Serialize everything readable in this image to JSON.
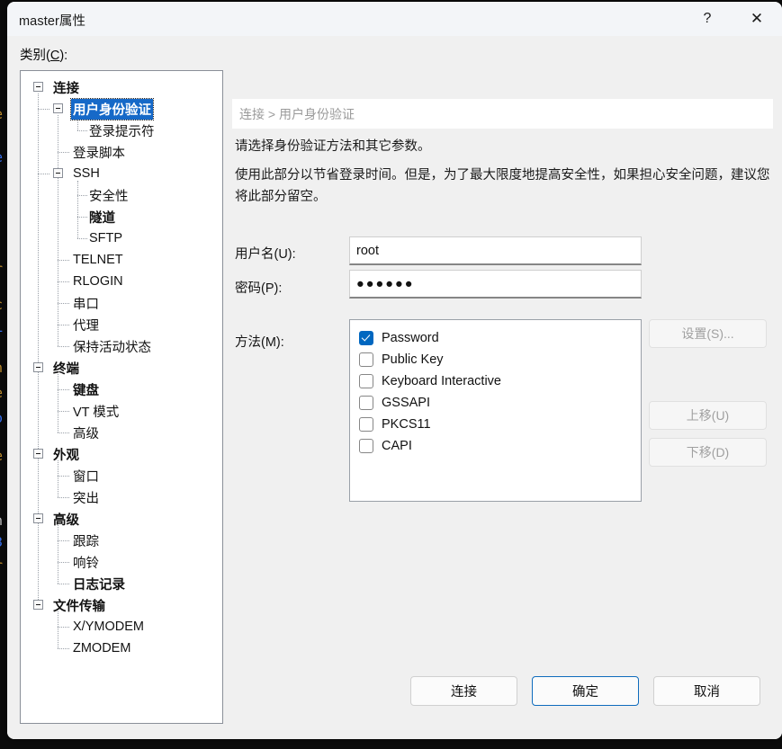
{
  "window": {
    "title": "master属性",
    "help_label": "?",
    "close_label": "✕"
  },
  "category": {
    "label_prefix": "类别(",
    "accel": "C",
    "label_suffix": "):"
  },
  "tree": {
    "items": [
      {
        "label": "连接",
        "depth": 0,
        "bold": true,
        "expander": true,
        "selected": false
      },
      {
        "label": "用户身份验证",
        "depth": 1,
        "bold": true,
        "expander": true,
        "selected": true
      },
      {
        "label": "登录提示符",
        "depth": 2,
        "bold": false,
        "expander": false,
        "selected": false
      },
      {
        "label": "登录脚本",
        "depth": 1,
        "bold": false,
        "expander": false,
        "selected": false
      },
      {
        "label": "SSH",
        "depth": 1,
        "bold": false,
        "expander": true,
        "selected": false
      },
      {
        "label": "安全性",
        "depth": 2,
        "bold": false,
        "expander": false,
        "selected": false
      },
      {
        "label": "隧道",
        "depth": 2,
        "bold": true,
        "expander": false,
        "selected": false
      },
      {
        "label": "SFTP",
        "depth": 2,
        "bold": false,
        "expander": false,
        "selected": false
      },
      {
        "label": "TELNET",
        "depth": 1,
        "bold": false,
        "expander": false,
        "selected": false
      },
      {
        "label": "RLOGIN",
        "depth": 1,
        "bold": false,
        "expander": false,
        "selected": false
      },
      {
        "label": "串口",
        "depth": 1,
        "bold": false,
        "expander": false,
        "selected": false
      },
      {
        "label": "代理",
        "depth": 1,
        "bold": false,
        "expander": false,
        "selected": false
      },
      {
        "label": "保持活动状态",
        "depth": 1,
        "bold": false,
        "expander": false,
        "selected": false
      },
      {
        "label": "终端",
        "depth": 0,
        "bold": true,
        "expander": true,
        "selected": false
      },
      {
        "label": "键盘",
        "depth": 1,
        "bold": true,
        "expander": false,
        "selected": false
      },
      {
        "label": "VT 模式",
        "depth": 1,
        "bold": false,
        "expander": false,
        "selected": false
      },
      {
        "label": "高级",
        "depth": 1,
        "bold": false,
        "expander": false,
        "selected": false
      },
      {
        "label": "外观",
        "depth": 0,
        "bold": true,
        "expander": true,
        "selected": false
      },
      {
        "label": "窗口",
        "depth": 1,
        "bold": false,
        "expander": false,
        "selected": false
      },
      {
        "label": "突出",
        "depth": 1,
        "bold": false,
        "expander": false,
        "selected": false
      },
      {
        "label": "高级",
        "depth": 0,
        "bold": true,
        "expander": true,
        "selected": false
      },
      {
        "label": "跟踪",
        "depth": 1,
        "bold": false,
        "expander": false,
        "selected": false
      },
      {
        "label": "响铃",
        "depth": 1,
        "bold": false,
        "expander": false,
        "selected": false
      },
      {
        "label": "日志记录",
        "depth": 1,
        "bold": true,
        "expander": false,
        "selected": false
      },
      {
        "label": "文件传输",
        "depth": 0,
        "bold": true,
        "expander": true,
        "selected": false
      },
      {
        "label": "X/YMODEM",
        "depth": 1,
        "bold": false,
        "expander": false,
        "selected": false
      },
      {
        "label": "ZMODEM",
        "depth": 1,
        "bold": false,
        "expander": false,
        "selected": false
      }
    ]
  },
  "content": {
    "breadcrumb": "连接 > 用户身份验证",
    "description_1": "请选择身份验证方法和其它参数。",
    "description_2": "使用此部分以节省登录时间。但是，为了最大限度地提高安全性，如果担心安全问题，建议您将此部分留空。",
    "username": {
      "label": "用户名(U):",
      "value": "root"
    },
    "password": {
      "label": "密码(P):",
      "value": "●●●●●●"
    },
    "method": {
      "label": "方法(M):",
      "options": [
        {
          "label": "Password",
          "checked": true
        },
        {
          "label": "Public Key",
          "checked": false
        },
        {
          "label": "Keyboard Interactive",
          "checked": false
        },
        {
          "label": "GSSAPI",
          "checked": false
        },
        {
          "label": "PKCS11",
          "checked": false
        },
        {
          "label": "CAPI",
          "checked": false
        }
      ]
    },
    "side_buttons": {
      "settings": "设置(S)...",
      "move_up": "上移(U)",
      "move_down": "下移(D)"
    }
  },
  "footer": {
    "connect": "连接",
    "ok": "确定",
    "cancel": "取消"
  },
  "colors": {
    "accent": "#0067c0",
    "selection": "#1669c8",
    "default_button_border": "#0f6cbd",
    "dialog_bg": "#f0f0f0",
    "titlebar_bg": "#f3f5f8"
  },
  "background_terminal": {
    "fragment_lines": [
      "e",
      "e",
      "r",
      "c",
      "L",
      "n",
      "e",
      "o",
      "e",
      "n",
      "3",
      "r"
    ]
  }
}
